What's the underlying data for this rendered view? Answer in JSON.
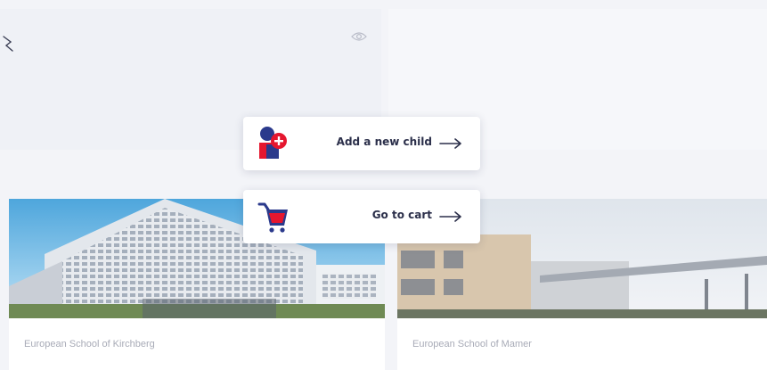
{
  "colors": {
    "navy": "#2b3a8c",
    "red": "#e5172f",
    "text_dark": "#2b2f4a",
    "text_muted": "#a8abb7"
  },
  "actions": {
    "add_child": {
      "label": "Add a new child",
      "icon": "add-child-icon"
    },
    "cart": {
      "label": "Go to cart",
      "icon": "cart-icon"
    }
  },
  "schools": [
    {
      "name": "European School of Kirchberg"
    },
    {
      "name": "European School of Mamer"
    }
  ],
  "icons": {
    "visibility": "eye-icon",
    "arrow": "arrow-right-icon"
  }
}
